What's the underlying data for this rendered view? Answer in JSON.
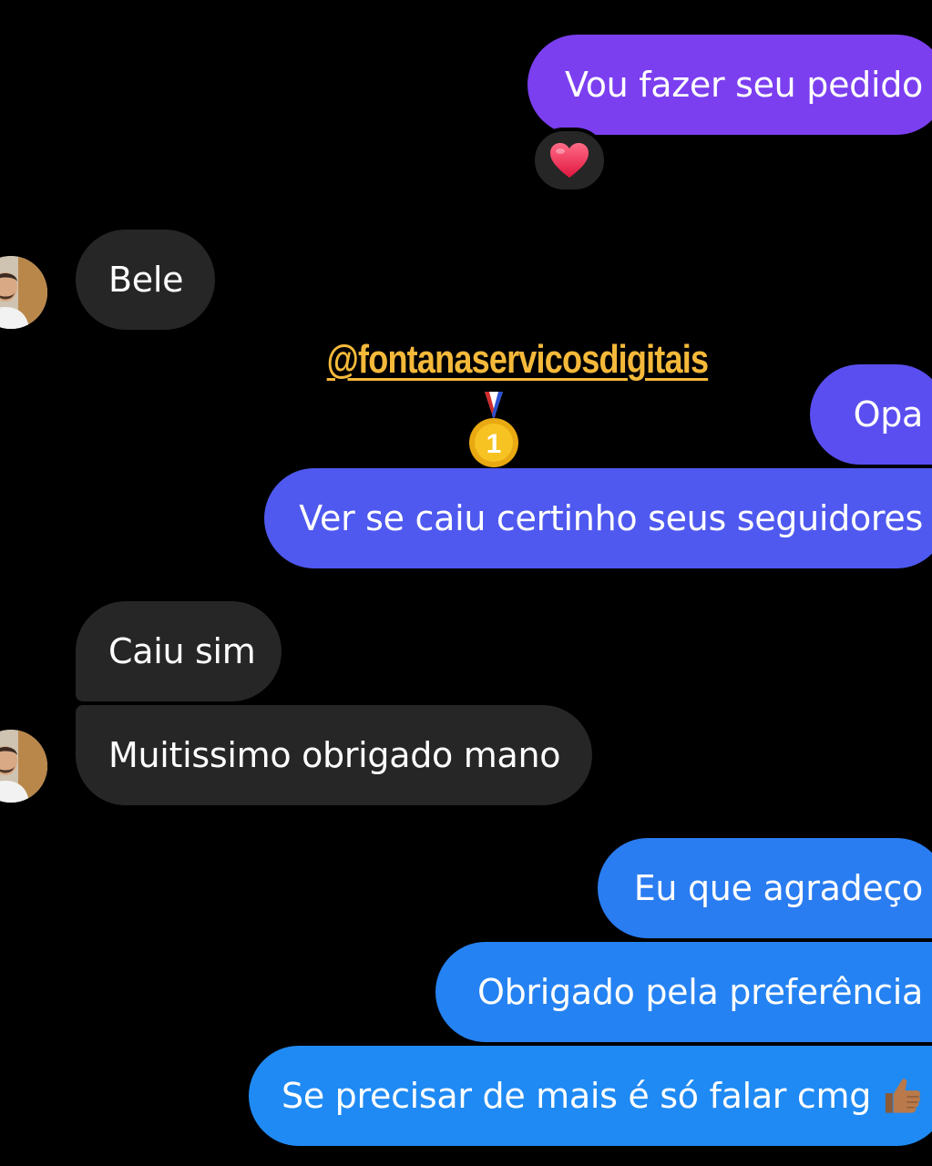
{
  "watermark": {
    "handle": "@fontanaservicosdigitais"
  },
  "messages": {
    "m1": "Vou fazer seu pedido",
    "m2": "Bele",
    "m3": "Opa",
    "m4": "Ver se caiu certinho seus seguidores",
    "m5": "Caiu sim",
    "m6": "Muitissimo obrigado mano",
    "m7": "Eu que agradeço",
    "m8": "Obrigado pela preferência",
    "m9": "Se precisar de mais é só falar cmg"
  },
  "icons": {
    "reaction": "heart-icon",
    "medal": "first-place-medal-icon",
    "thumb": "thumbs-up-icon"
  },
  "colors": {
    "background": "#000000",
    "incoming_bubble": "#262626",
    "outgoing_top": "#7b3ff0",
    "outgoing_bottom": "#1f8af3",
    "watermark": "#f5b93a"
  }
}
